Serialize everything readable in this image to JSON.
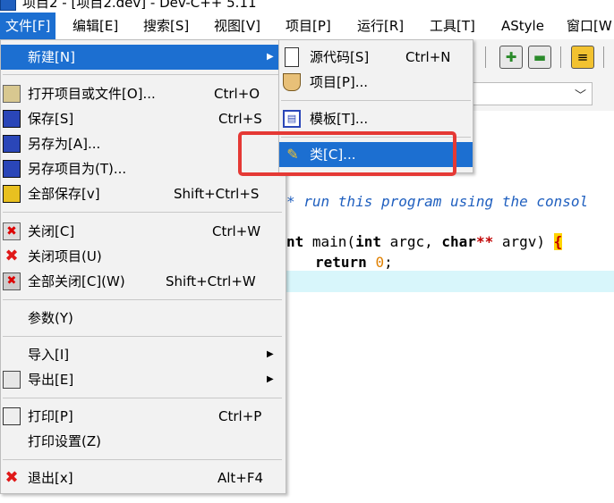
{
  "window": {
    "title": "项目2 - [项目2.dev] - Dev-C++ 5.11"
  },
  "menubar": [
    {
      "label": "文件[F]"
    },
    {
      "label": "编辑[E]"
    },
    {
      "label": "搜索[S]"
    },
    {
      "label": "视图[V]"
    },
    {
      "label": "项目[P]"
    },
    {
      "label": "运行[R]"
    },
    {
      "label": "工具[T]"
    },
    {
      "label": "AStyle"
    },
    {
      "label": "窗口[W"
    }
  ],
  "file_menu": {
    "items": [
      {
        "label": "新建[N]",
        "shortcut": "",
        "icon": "none",
        "submenu": true
      },
      {
        "label": "打开项目或文件[O]...",
        "shortcut": "Ctrl+O",
        "icon": "open-folder-icon"
      },
      {
        "label": "保存[S]",
        "shortcut": "Ctrl+S",
        "icon": "floppy-disk-icon"
      },
      {
        "label": "另存为[A]...",
        "shortcut": "",
        "icon": "floppy-disk-icon"
      },
      {
        "label": "另存项目为(T)...",
        "shortcut": "",
        "icon": "floppy-disk-icon"
      },
      {
        "label": "全部保存[v]",
        "shortcut": "Shift+Ctrl+S",
        "icon": "save-all-icon"
      },
      {
        "label": "关闭[C]",
        "shortcut": "Ctrl+W",
        "icon": "close-file-icon"
      },
      {
        "label": "关闭项目(U)",
        "shortcut": "",
        "icon": "red-x-icon"
      },
      {
        "label": "全部关闭[C](W)",
        "shortcut": "Shift+Ctrl+W",
        "icon": "close-all-icon"
      },
      {
        "label": "参数(Y)",
        "shortcut": "",
        "icon": "none"
      },
      {
        "label": "导入[I]",
        "shortcut": "",
        "icon": "none",
        "submenu": true
      },
      {
        "label": "导出[E]",
        "shortcut": "",
        "icon": "export-icon",
        "submenu": true
      },
      {
        "label": "打印[P]",
        "shortcut": "Ctrl+P",
        "icon": "printer-icon"
      },
      {
        "label": "打印设置(Z)",
        "shortcut": "",
        "icon": "none"
      },
      {
        "label": "退出[x]",
        "shortcut": "Alt+F4",
        "icon": "red-x-icon"
      }
    ]
  },
  "new_submenu": {
    "items": [
      {
        "label": "源代码[S]",
        "shortcut": "Ctrl+N",
        "icon": "blank-page-icon"
      },
      {
        "label": "项目[P]...",
        "shortcut": "",
        "icon": "project-icon"
      },
      {
        "label": "模板[T]...",
        "shortcut": "",
        "icon": "template-icon"
      },
      {
        "label": "类[C]...",
        "shortcut": "",
        "icon": "class-wand-icon"
      }
    ]
  },
  "editor": {
    "line1_comment": "* run this program using the consol",
    "line2_kw1": "nt",
    "line2_fn": " main(",
    "line2_kw2": "int",
    "line2_mid": " argc, ",
    "line2_kw3": "char",
    "line2_stars": "**",
    "line2_end": " argv) ",
    "line2_brace": "{",
    "line3_kw": "return",
    "line3_num": "0",
    "line3_semi": ";"
  },
  "colors": {
    "menu_highlight": "#1c6fd1",
    "annotation_box": "#e53935",
    "current_line": "#d8f6fb"
  }
}
